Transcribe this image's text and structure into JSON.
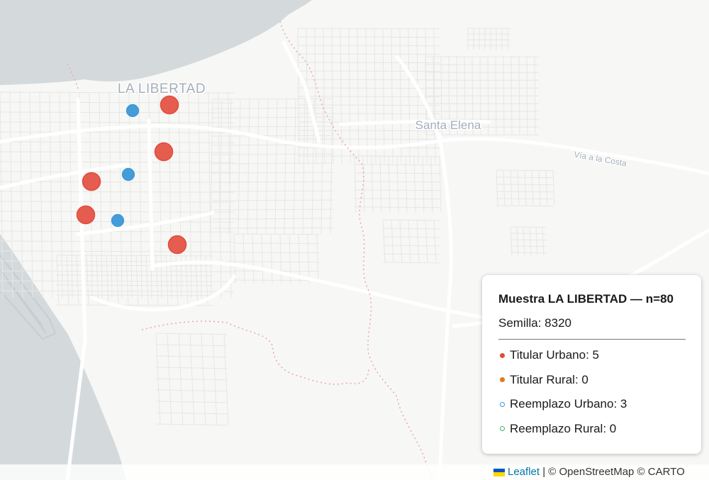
{
  "map": {
    "colors": {
      "land": "#f7f7f6",
      "water": "#d4dadc",
      "road_major": "#ffffff",
      "road_minor": "#e6e6e4",
      "border": "#e8a9a6",
      "label": "#a3aebb",
      "titular_urbano": "#e24b3d",
      "reemplazo_urbano": "#3a97d6"
    },
    "labels": {
      "la_libertad": "LA LIBERTAD",
      "santa_elena": "Santa Elena",
      "via_costa": "Vía a la Costa"
    },
    "markers": {
      "titular_urbano": 5,
      "reemplazo_urbano": 3
    }
  },
  "legend": {
    "title": "Muestra LA LIBERTAD — n=80",
    "seed": "Semilla: 8320",
    "items": [
      {
        "label": "Titular Urbano: 5",
        "style": "filled",
        "color": "#e24b3d"
      },
      {
        "label": "Titular Rural: 0",
        "style": "filled",
        "color": "#e07a1f"
      },
      {
        "label": "Reemplazo Urbano: 3",
        "style": "ring",
        "color": "#3a97d6"
      },
      {
        "label": "Reemplazo Rural: 0",
        "style": "ring",
        "color": "#3fb36e"
      }
    ]
  },
  "attribution": {
    "leaflet": "Leaflet",
    "rest": " | © OpenStreetMap © CARTO"
  }
}
